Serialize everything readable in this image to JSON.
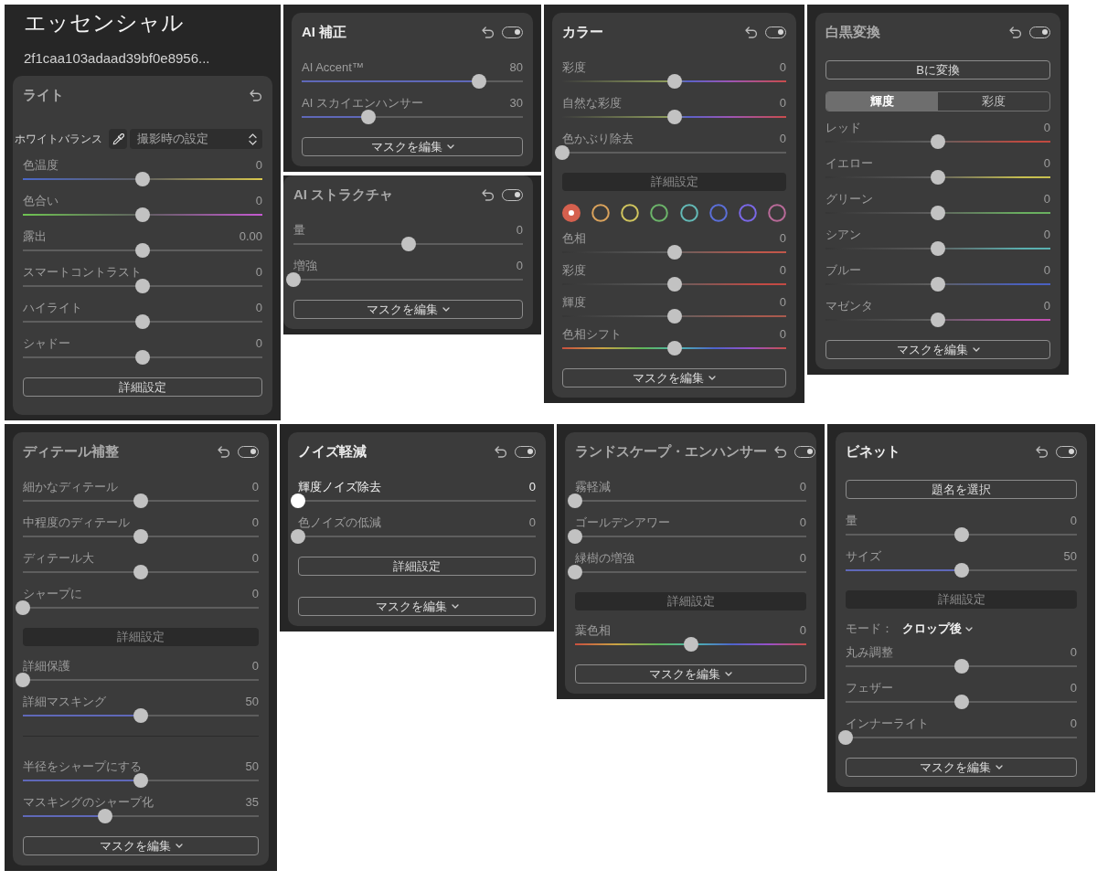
{
  "rows": [
    {
      "columns": [
        {
          "frames": [
            {
              "heading": "エッセンシャル",
              "file_name": "2f1caa103adaad39bf0e8956...",
              "panel": {
                "title": "ライト",
                "active": false,
                "items": [
                  {
                    "kind": "select",
                    "label": "ホワイトバランス",
                    "value": "撮影時の設定"
                  },
                  {
                    "kind": "slider",
                    "label": "色温度",
                    "value": "0",
                    "level": 0.5,
                    "track": {
                      "kind": "temperature"
                    }
                  },
                  {
                    "kind": "slider",
                    "label": "色合い",
                    "value": "0",
                    "level": 0.5,
                    "track": {
                      "kind": "tint"
                    }
                  },
                  {
                    "kind": "slider",
                    "label": "露出",
                    "value": "0.00",
                    "level": 0.5,
                    "track": {
                      "kind": "plain"
                    }
                  },
                  {
                    "kind": "slider",
                    "label": "スマートコントラスト",
                    "value": "0",
                    "level": 0.5,
                    "track": {
                      "kind": "plain"
                    }
                  },
                  {
                    "kind": "slider",
                    "label": "ハイライト",
                    "value": "0",
                    "level": 0.5,
                    "track": {
                      "kind": "plain"
                    }
                  },
                  {
                    "kind": "slider",
                    "label": "シャドー",
                    "value": "0",
                    "level": 0.5,
                    "track": {
                      "kind": "plain"
                    }
                  },
                  {
                    "kind": "button",
                    "label": "詳細設定"
                  }
                ]
              }
            }
          ]
        },
        {
          "frames": [
            {
              "panel": {
                "title": "AI 補正",
                "active": true,
                "toggle": {
                  "on": true
                },
                "items": [
                  {
                    "kind": "slider",
                    "label": "AI Accent™",
                    "value": "80",
                    "level": 0.8,
                    "track": {
                      "kind": "fill"
                    }
                  },
                  {
                    "kind": "slider",
                    "label": "AI スカイエンハンサー",
                    "value": "30",
                    "level": 0.3,
                    "track": {
                      "kind": "fill"
                    }
                  },
                  {
                    "kind": "menu",
                    "label": "マスクを編集"
                  }
                ]
              }
            },
            {
              "panel": {
                "title": "AI ストラクチャ",
                "active": false,
                "toggle": {
                  "on": true
                },
                "items": [
                  {
                    "kind": "slider",
                    "label": "量",
                    "value": "0",
                    "level": 0.5,
                    "track": {
                      "kind": "plain"
                    }
                  },
                  {
                    "kind": "slider",
                    "label": "増強",
                    "value": "0",
                    "level": 0,
                    "track": {
                      "kind": "plain"
                    }
                  },
                  {
                    "kind": "menu",
                    "label": "マスクを編集"
                  }
                ]
              }
            }
          ]
        },
        {
          "frames": [
            {
              "panel": {
                "title": "カラー",
                "active": true,
                "toggle": {
                  "on": true
                },
                "items": [
                  {
                    "kind": "slider",
                    "label": "彩度",
                    "value": "0",
                    "level": 0.5,
                    "track": {
                      "kind": "saturation"
                    }
                  },
                  {
                    "kind": "slider",
                    "label": "自然な彩度",
                    "value": "0",
                    "level": 0.5,
                    "track": {
                      "kind": "saturation"
                    }
                  },
                  {
                    "kind": "slider",
                    "label": "色かぶり除去",
                    "value": "0",
                    "level": 0,
                    "track": {
                      "kind": "plain"
                    }
                  },
                  {
                    "kind": "section",
                    "label": "詳細設定"
                  },
                  {
                    "kind": "swatches",
                    "swatches": [
                      {
                        "color": "#d5604e",
                        "selected": true
                      },
                      {
                        "color": "#d9a25c",
                        "selected": false
                      },
                      {
                        "color": "#cfc45e",
                        "selected": false
                      },
                      {
                        "color": "#6cb46a",
                        "selected": false
                      },
                      {
                        "color": "#63b9b6",
                        "selected": false
                      },
                      {
                        "color": "#5b6fd8",
                        "selected": false
                      },
                      {
                        "color": "#7a68e6",
                        "selected": false
                      },
                      {
                        "color": "#b86a98",
                        "selected": false
                      }
                    ]
                  },
                  {
                    "kind": "slider",
                    "label": "色相",
                    "value": "0",
                    "level": 0.5,
                    "track": {
                      "kind": "tinted",
                      "color": "#c0574a"
                    }
                  },
                  {
                    "kind": "slider",
                    "label": "彩度",
                    "value": "0",
                    "level": 0.5,
                    "track": {
                      "kind": "tinted",
                      "color": "#c24a44"
                    }
                  },
                  {
                    "kind": "slider",
                    "label": "輝度",
                    "value": "0",
                    "level": 0.5,
                    "track": {
                      "kind": "tinted",
                      "color": "#a85a4e"
                    }
                  },
                  {
                    "kind": "slider",
                    "label": "色相シフト",
                    "value": "0",
                    "level": 0.5,
                    "track": {
                      "kind": "spectrum"
                    }
                  },
                  {
                    "kind": "menu",
                    "label": "マスクを編集"
                  }
                ]
              }
            }
          ]
        },
        {
          "frames": [
            {
              "panel": {
                "title": "白黒変換",
                "active": false,
                "toggle": {
                  "on": true
                },
                "items": [
                  {
                    "kind": "button",
                    "label": "Bに変換"
                  },
                  {
                    "kind": "segmented",
                    "options": [
                      {
                        "label": "輝度",
                        "selected": true
                      },
                      {
                        "label": "彩度",
                        "selected": false
                      }
                    ]
                  },
                  {
                    "kind": "slider",
                    "label": "レッド",
                    "value": "0",
                    "level": 0.5,
                    "track": {
                      "kind": "tinted",
                      "color": "#c04a40"
                    }
                  },
                  {
                    "kind": "slider",
                    "label": "イエロー",
                    "value": "0",
                    "level": 0.5,
                    "track": {
                      "kind": "tinted",
                      "color": "#c8c050"
                    }
                  },
                  {
                    "kind": "slider",
                    "label": "グリーン",
                    "value": "0",
                    "level": 0.5,
                    "track": {
                      "kind": "tinted",
                      "color": "#6ab060"
                    }
                  },
                  {
                    "kind": "slider",
                    "label": "シアン",
                    "value": "0",
                    "level": 0.5,
                    "track": {
                      "kind": "tinted",
                      "color": "#5ab0b0"
                    }
                  },
                  {
                    "kind": "slider",
                    "label": "ブルー",
                    "value": "0",
                    "level": 0.5,
                    "track": {
                      "kind": "tinted",
                      "color": "#4a60c0"
                    }
                  },
                  {
                    "kind": "slider",
                    "label": "マゼンタ",
                    "value": "0",
                    "level": 0.5,
                    "track": {
                      "kind": "tinted",
                      "color": "#c050b0"
                    }
                  },
                  {
                    "kind": "menu",
                    "label": "マスクを編集"
                  }
                ]
              }
            }
          ]
        }
      ]
    },
    {
      "columns": [
        {
          "frames": [
            {
              "panel": {
                "title": "ディテール補整",
                "active": false,
                "toggle": {
                  "on": true
                },
                "items": [
                  {
                    "kind": "slider",
                    "label": "細かなディテール",
                    "value": "0",
                    "level": 0.5,
                    "track": {
                      "kind": "plain"
                    }
                  },
                  {
                    "kind": "slider",
                    "label": "中程度のディテール",
                    "value": "0",
                    "level": 0.5,
                    "track": {
                      "kind": "plain"
                    }
                  },
                  {
                    "kind": "slider",
                    "label": "ディテール大",
                    "value": "0",
                    "level": 0.5,
                    "track": {
                      "kind": "plain"
                    }
                  },
                  {
                    "kind": "slider",
                    "label": "シャープに",
                    "value": "0",
                    "level": 0,
                    "track": {
                      "kind": "plain"
                    }
                  },
                  {
                    "kind": "section",
                    "label": "詳細設定"
                  },
                  {
                    "kind": "slider",
                    "label": "詳細保護",
                    "value": "0",
                    "level": 0,
                    "track": {
                      "kind": "plain"
                    }
                  },
                  {
                    "kind": "slider",
                    "label": "詳細マスキング",
                    "value": "50",
                    "level": 0.5,
                    "track": {
                      "kind": "fill"
                    }
                  },
                  {
                    "kind": "divider"
                  },
                  {
                    "kind": "slider",
                    "label": "半径をシャープにする",
                    "value": "50",
                    "level": 0.5,
                    "track": {
                      "kind": "fill"
                    }
                  },
                  {
                    "kind": "slider",
                    "label": "マスキングのシャープ化",
                    "value": "35",
                    "level": 0.35,
                    "track": {
                      "kind": "fill"
                    }
                  },
                  {
                    "kind": "menu",
                    "label": "マスクを編集"
                  }
                ]
              }
            }
          ]
        },
        {
          "frames": [
            {
              "panel": {
                "title": "ノイズ軽減",
                "active": true,
                "toggle": {
                  "on": true
                },
                "items": [
                  {
                    "kind": "slider",
                    "label": "輝度ノイズ除去",
                    "value": "0",
                    "level": 0,
                    "track": {
                      "kind": "plain"
                    },
                    "focused": true
                  },
                  {
                    "kind": "slider",
                    "label": "色ノイズの低減",
                    "value": "0",
                    "level": 0,
                    "track": {
                      "kind": "plain"
                    },
                    "focused": false
                  },
                  {
                    "kind": "button",
                    "label": "詳細設定"
                  },
                  {
                    "kind": "menu",
                    "label": "マスクを編集"
                  }
                ]
              }
            }
          ]
        },
        {
          "frames": [
            {
              "panel": {
                "title": "ランドスケープ・エンハンサー",
                "active": false,
                "toggle": {
                  "on": true
                },
                "items": [
                  {
                    "kind": "slider",
                    "label": "霧軽減",
                    "value": "0",
                    "level": 0,
                    "track": {
                      "kind": "plain"
                    }
                  },
                  {
                    "kind": "slider",
                    "label": "ゴールデンアワー",
                    "value": "0",
                    "level": 0,
                    "track": {
                      "kind": "plain"
                    }
                  },
                  {
                    "kind": "slider",
                    "label": "緑樹の増強",
                    "value": "0",
                    "level": 0,
                    "track": {
                      "kind": "plain"
                    }
                  },
                  {
                    "kind": "section",
                    "label": "詳細設定"
                  },
                  {
                    "kind": "slider",
                    "label": "葉色相",
                    "value": "0",
                    "level": 0.5,
                    "track": {
                      "kind": "spectrum"
                    }
                  },
                  {
                    "kind": "menu",
                    "label": "マスクを編集"
                  }
                ]
              }
            }
          ]
        },
        {
          "frames": [
            {
              "panel": {
                "title": "ビネット",
                "active": true,
                "toggle": {
                  "on": true
                },
                "items": [
                  {
                    "kind": "button",
                    "label": "題名を選択"
                  },
                  {
                    "kind": "slider",
                    "label": "量",
                    "value": "0",
                    "level": 0.5,
                    "track": {
                      "kind": "plain"
                    }
                  },
                  {
                    "kind": "slider",
                    "label": "サイズ",
                    "value": "50",
                    "level": 0.5,
                    "track": {
                      "kind": "fill"
                    }
                  },
                  {
                    "kind": "section",
                    "label": "詳細設定"
                  },
                  {
                    "kind": "mode",
                    "label": "モード：",
                    "value": "クロップ後"
                  },
                  {
                    "kind": "slider",
                    "label": "丸み調整",
                    "value": "0",
                    "level": 0.5,
                    "track": {
                      "kind": "plain"
                    }
                  },
                  {
                    "kind": "slider",
                    "label": "フェザー",
                    "value": "0",
                    "level": 0.5,
                    "track": {
                      "kind": "plain"
                    }
                  },
                  {
                    "kind": "slider",
                    "label": "インナーライト",
                    "value": "0",
                    "level": 0,
                    "track": {
                      "kind": "plain"
                    }
                  },
                  {
                    "kind": "menu",
                    "label": "マスクを編集"
                  }
                ]
              }
            }
          ]
        }
      ]
    }
  ]
}
